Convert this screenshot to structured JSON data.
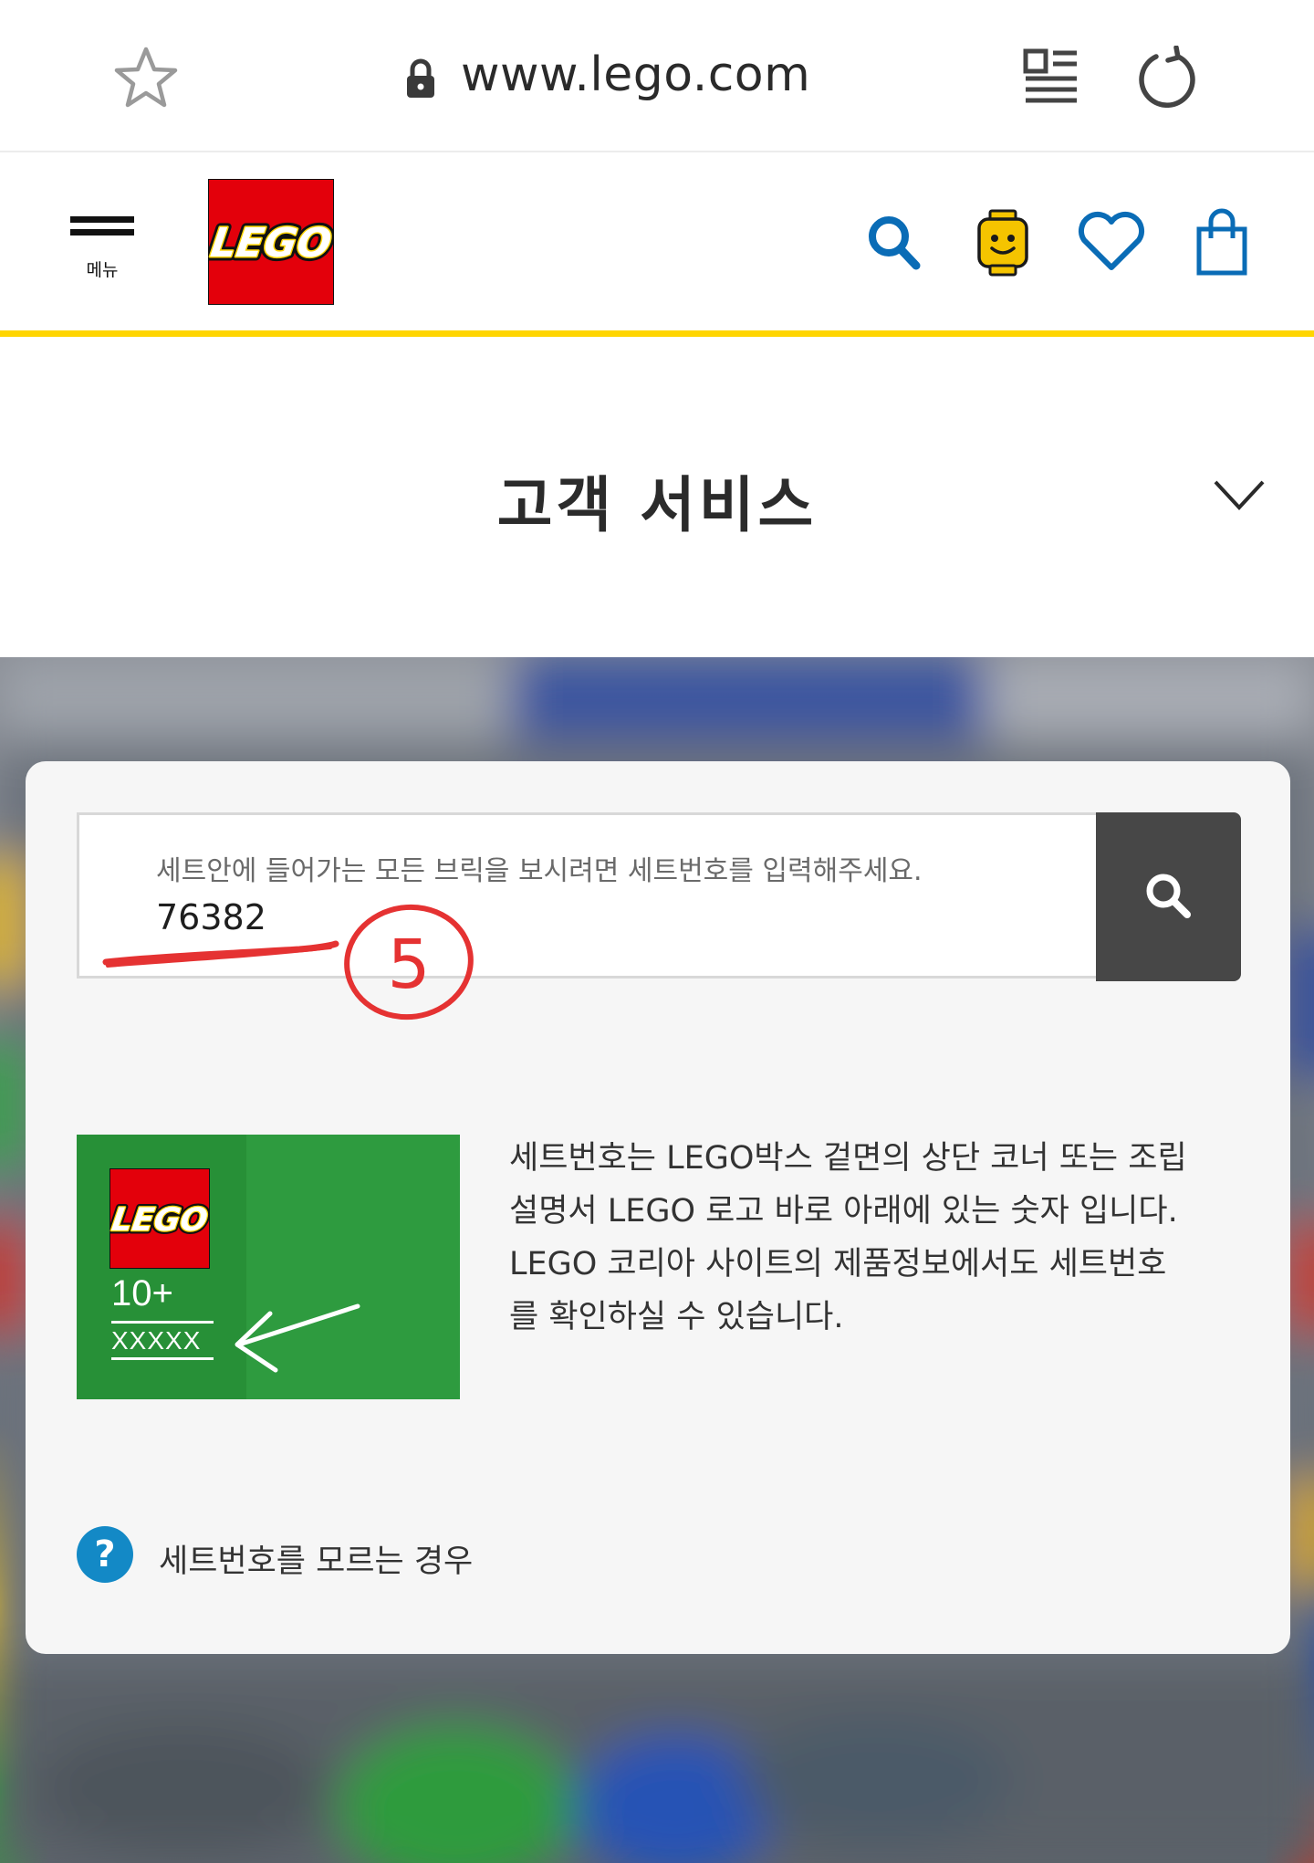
{
  "browser": {
    "url": "www.lego.com"
  },
  "header": {
    "menu_label": "메뉴",
    "logo_text": "LEGO",
    "accent_color": "#ffd500",
    "brand_red": "#e3000b",
    "icons": [
      "search-icon",
      "minifig-head-icon",
      "heart-icon",
      "shopping-bag-icon"
    ]
  },
  "page": {
    "title": "고객 서비스"
  },
  "search": {
    "placeholder": "세트안에 들어가는 모든 브릭을 보시려면 세트번호를 입력해주세요.",
    "value": "76382",
    "annotation": "5"
  },
  "info": {
    "image_age": "10+",
    "image_set_number": "XXXXX",
    "description_lines": [
      "세트번호는 LEGO박스 겉면의 상단 코너 또는 조립",
      "설명서 LEGO 로고 바로 아래에 있는 숫자 입니다.",
      "LEGO 코리아 사이트의 제품정보에서도 세트번호",
      "를 확인하실 수 있습니다."
    ]
  },
  "help": {
    "icon_label": "?",
    "link_text": "세트번호를 모르는 경우"
  }
}
